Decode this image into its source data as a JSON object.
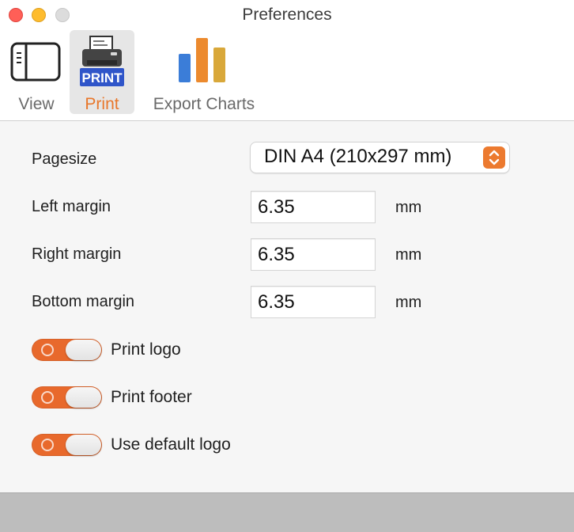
{
  "window": {
    "title": "Preferences"
  },
  "toolbar": {
    "items": [
      {
        "label": "View",
        "icon": "sidebar-window-icon",
        "selected": false
      },
      {
        "label": "Print",
        "icon": "printer-icon",
        "icon_text": "PRINT",
        "selected": true
      },
      {
        "label": "Export Charts",
        "icon": "bar-chart-icon",
        "selected": false
      }
    ]
  },
  "form": {
    "pagesize": {
      "label": "Pagesize",
      "value": "DIN A4 (210x297 mm)"
    },
    "left_margin": {
      "label": "Left margin",
      "value": "6.35",
      "unit": "mm"
    },
    "right_margin": {
      "label": "Right margin",
      "value": "6.35",
      "unit": "mm"
    },
    "bottom_margin": {
      "label": "Bottom margin",
      "value": "6.35",
      "unit": "mm"
    }
  },
  "toggles": [
    {
      "label": "Print logo",
      "on": true
    },
    {
      "label": "Print footer",
      "on": true
    },
    {
      "label": "Use default logo",
      "on": true
    }
  ],
  "colors": {
    "accent": "#e8772b",
    "toggle_on": "#e8692c",
    "close": "#ff5f57",
    "minimize": "#febc2e",
    "zoom_inactive": "#dcdcdc",
    "chart_blue": "#3b7dd8",
    "chart_orange": "#ec8a2e",
    "chart_gold": "#d9a83a",
    "print_badge": "#2f55c9"
  }
}
